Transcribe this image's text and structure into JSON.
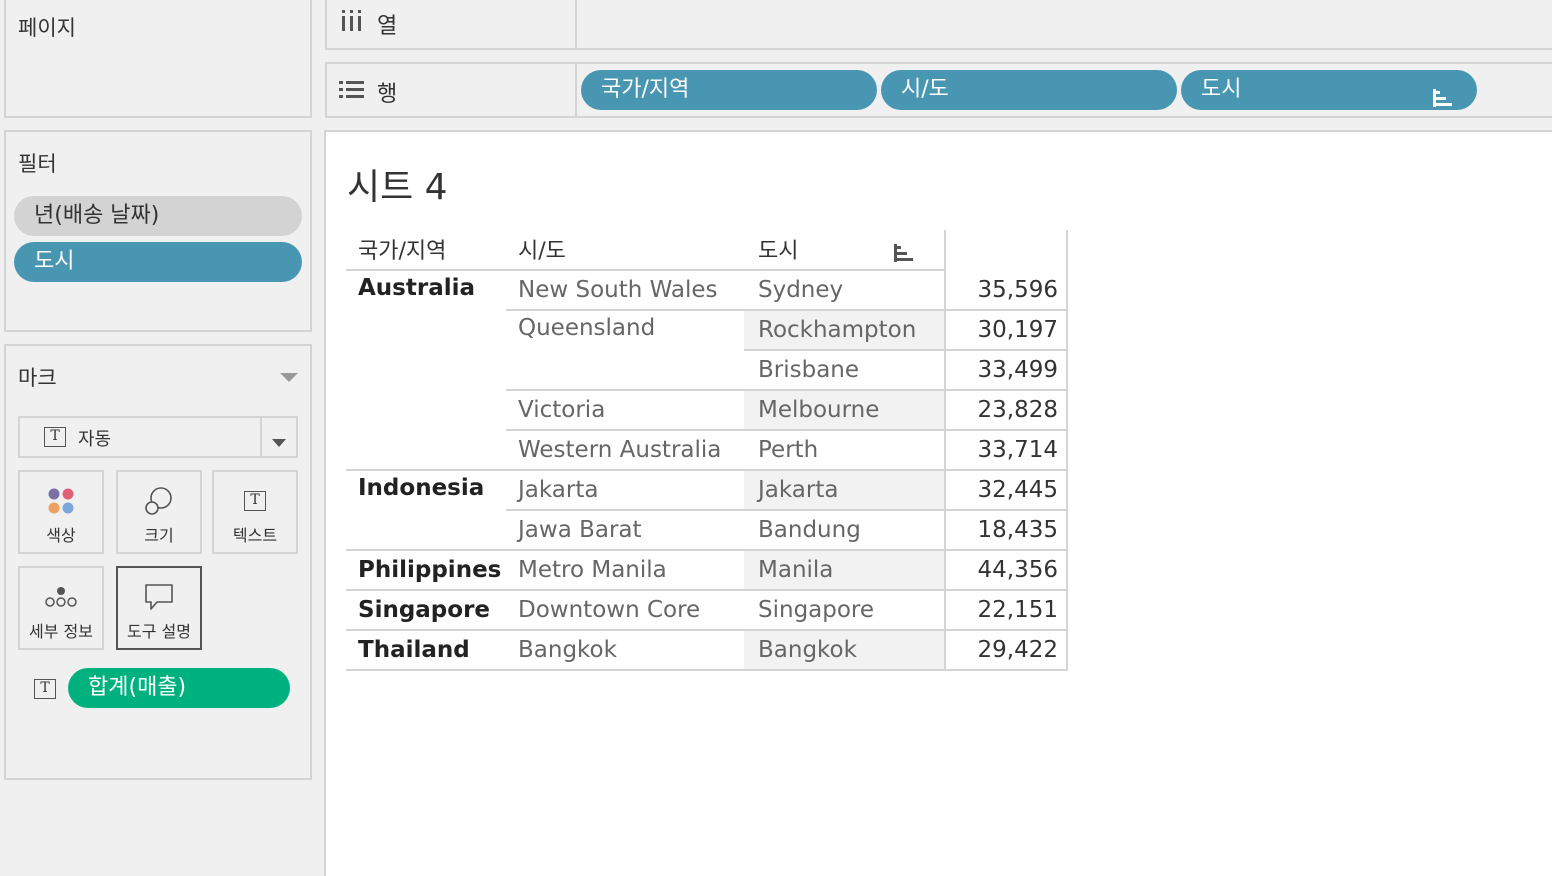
{
  "pages_panel": {
    "title": "페이지"
  },
  "columns_shelf": {
    "label": "열",
    "icon": "columns-icon"
  },
  "rows_shelf": {
    "label": "행",
    "icon": "rows-icon",
    "pills": [
      "국가/지역",
      "시/도",
      "도시"
    ]
  },
  "filters_panel": {
    "title": "필터",
    "pills": [
      "년(배송 날짜)",
      "도시"
    ]
  },
  "marks_panel": {
    "title": "마크",
    "mark_type": "자동",
    "cards": [
      "색상",
      "크기",
      "텍스트",
      "세부 정보",
      "도구 설명"
    ],
    "field_pill": "합계(매출)"
  },
  "sheet": {
    "title": "시트 4",
    "headers": [
      "국가/지역",
      "시/도",
      "도시"
    ],
    "rows": [
      {
        "country": "Australia",
        "state": "New South Wales",
        "city": "Sydney",
        "value": "35,596"
      },
      {
        "country": "",
        "state": "Queensland",
        "city": "Rockhampton",
        "value": "30,197"
      },
      {
        "country": "",
        "state": "",
        "city": "Brisbane",
        "value": "33,499"
      },
      {
        "country": "",
        "state": "Victoria",
        "city": "Melbourne",
        "value": "23,828"
      },
      {
        "country": "",
        "state": "Western Australia",
        "city": "Perth",
        "value": "33,714"
      },
      {
        "country": "Indonesia",
        "state": "Jakarta",
        "city": "Jakarta",
        "value": "32,445"
      },
      {
        "country": "",
        "state": "Jawa Barat",
        "city": "Bandung",
        "value": "18,435"
      },
      {
        "country": "Philippines",
        "state": "Metro Manila",
        "city": "Manila",
        "value": "44,356"
      },
      {
        "country": "Singapore",
        "state": "Downtown Core",
        "city": "Singapore",
        "value": "22,151"
      },
      {
        "country": "Thailand",
        "state": "Bangkok",
        "city": "Bangkok",
        "value": "29,422"
      }
    ]
  }
}
